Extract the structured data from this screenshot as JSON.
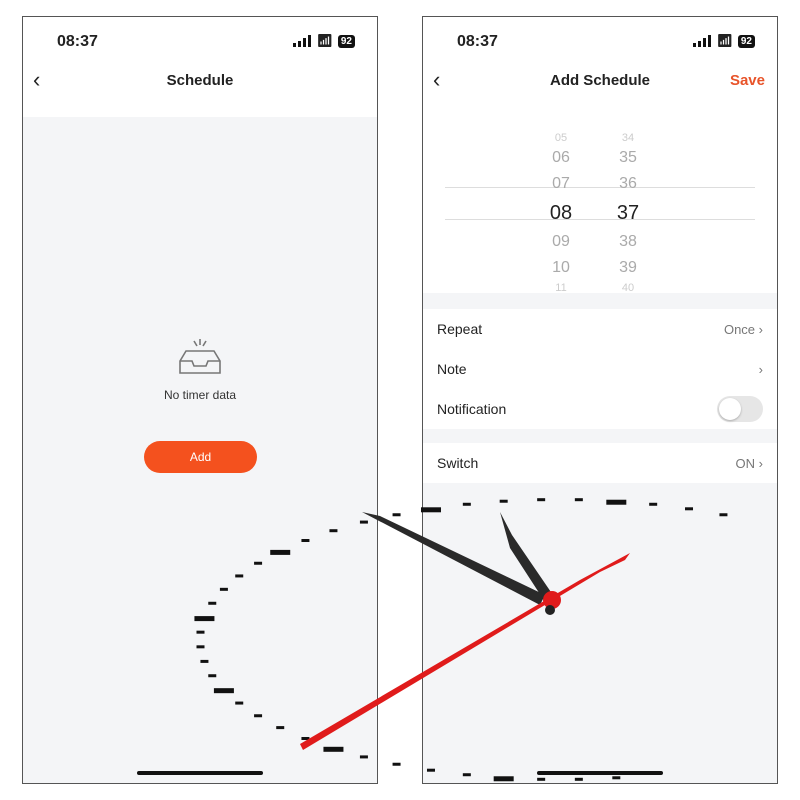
{
  "status": {
    "time": "08:37",
    "battery": "92"
  },
  "left": {
    "title": "Schedule",
    "empty_text": "No timer data",
    "add_label": "Add"
  },
  "right": {
    "title": "Add Schedule",
    "save_label": "Save",
    "hours": [
      "05",
      "06",
      "07",
      "08",
      "09",
      "10",
      "11"
    ],
    "minutes": [
      "34",
      "35",
      "36",
      "37",
      "38",
      "39",
      "40"
    ],
    "rows": [
      {
        "label": "Repeat",
        "value": "Once"
      },
      {
        "label": "Note",
        "value": ""
      },
      {
        "label": "Notification",
        "value": ""
      },
      {
        "label": "Switch",
        "value": "ON"
      }
    ],
    "notification_on": false
  },
  "colors": {
    "accent": "#f4511e",
    "save": "#e8542a"
  }
}
